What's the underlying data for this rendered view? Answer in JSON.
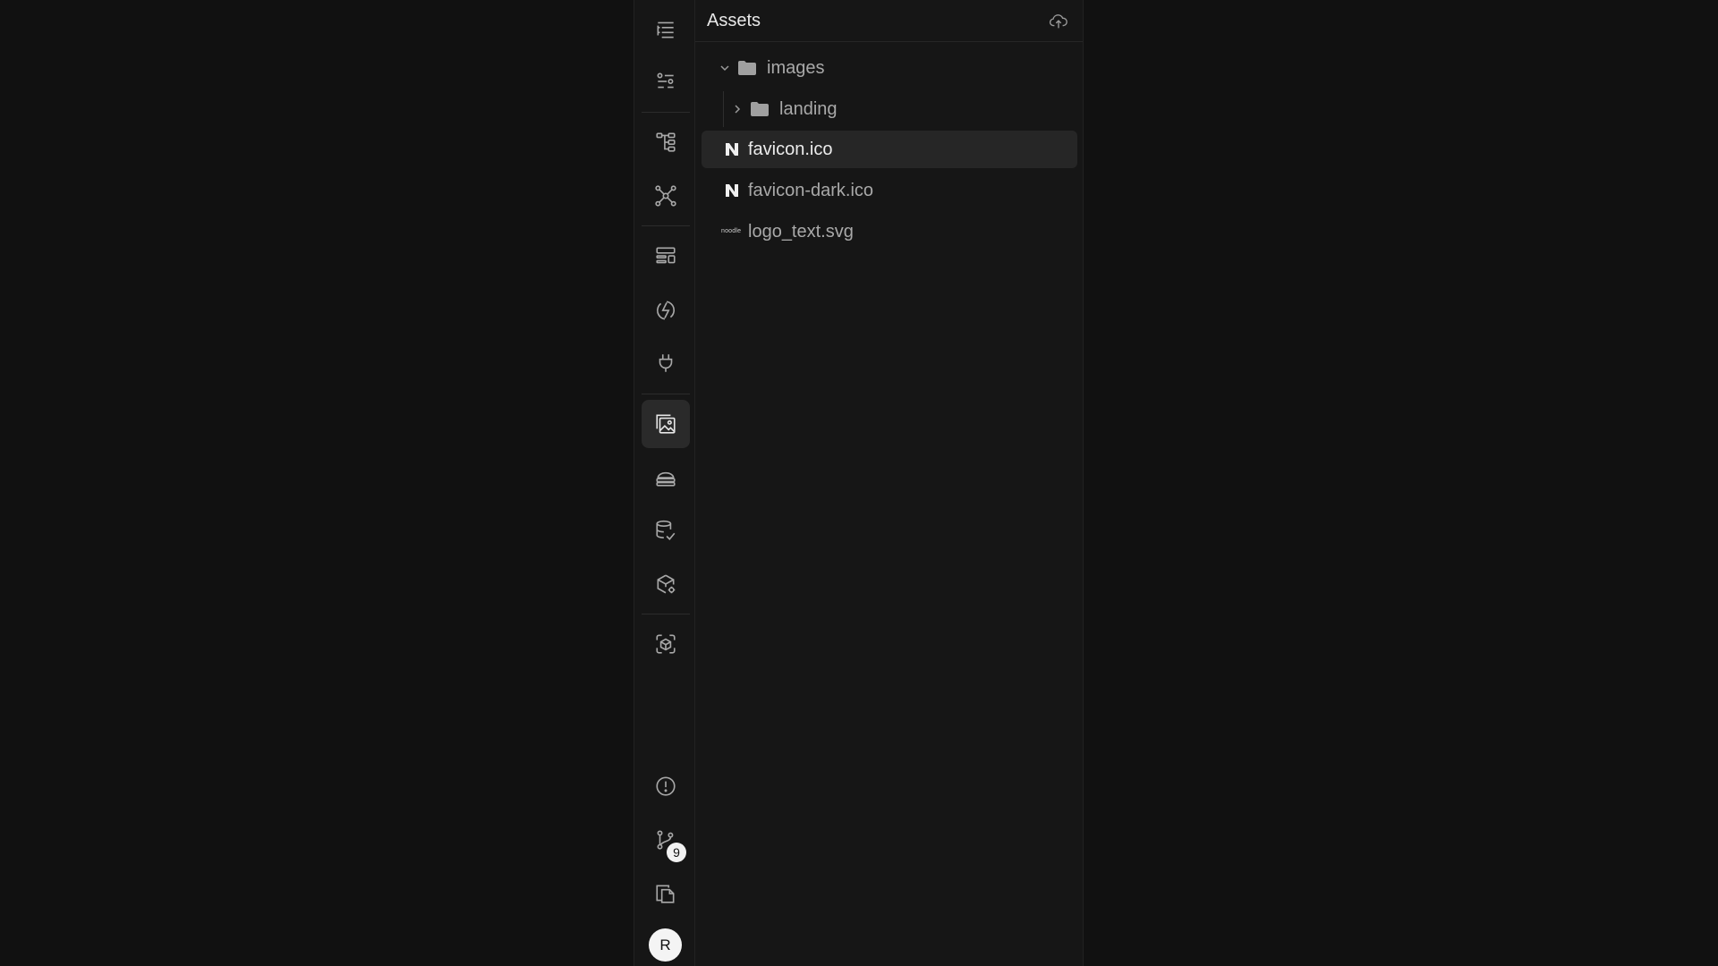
{
  "panel": {
    "title": "Assets"
  },
  "tree": {
    "images_label": "images",
    "landing_label": "landing",
    "favicon_label": "favicon.ico",
    "favicon_dark_label": "favicon-dark.ico",
    "logo_text_label": "logo_text.svg",
    "logo_thumb_text": "noodle"
  },
  "rail": {
    "branch_badge": "9",
    "avatar_initial": "R"
  },
  "colors": {
    "background": "#111111",
    "panel": "#161616",
    "selected_row": "#262626",
    "active_rail_button": "#2a2a2a"
  },
  "icons": {
    "rail": [
      "outline-list-icon",
      "sliders-list-icon",
      "tree-structure-icon",
      "graph-nodes-icon",
      "layout-blocks-icon",
      "lightning-circle-icon",
      "plug-icon",
      "image-gallery-icon",
      "cloud-stack-icon",
      "database-check-icon",
      "cube-gear-icon",
      "cube-scan-icon",
      "alert-circle-icon",
      "git-branch-icon",
      "files-copy-icon"
    ],
    "panel": [
      "upload-cloud-icon",
      "chevron-down-icon",
      "chevron-right-icon",
      "folder-icon",
      "n-logo-icon"
    ]
  }
}
